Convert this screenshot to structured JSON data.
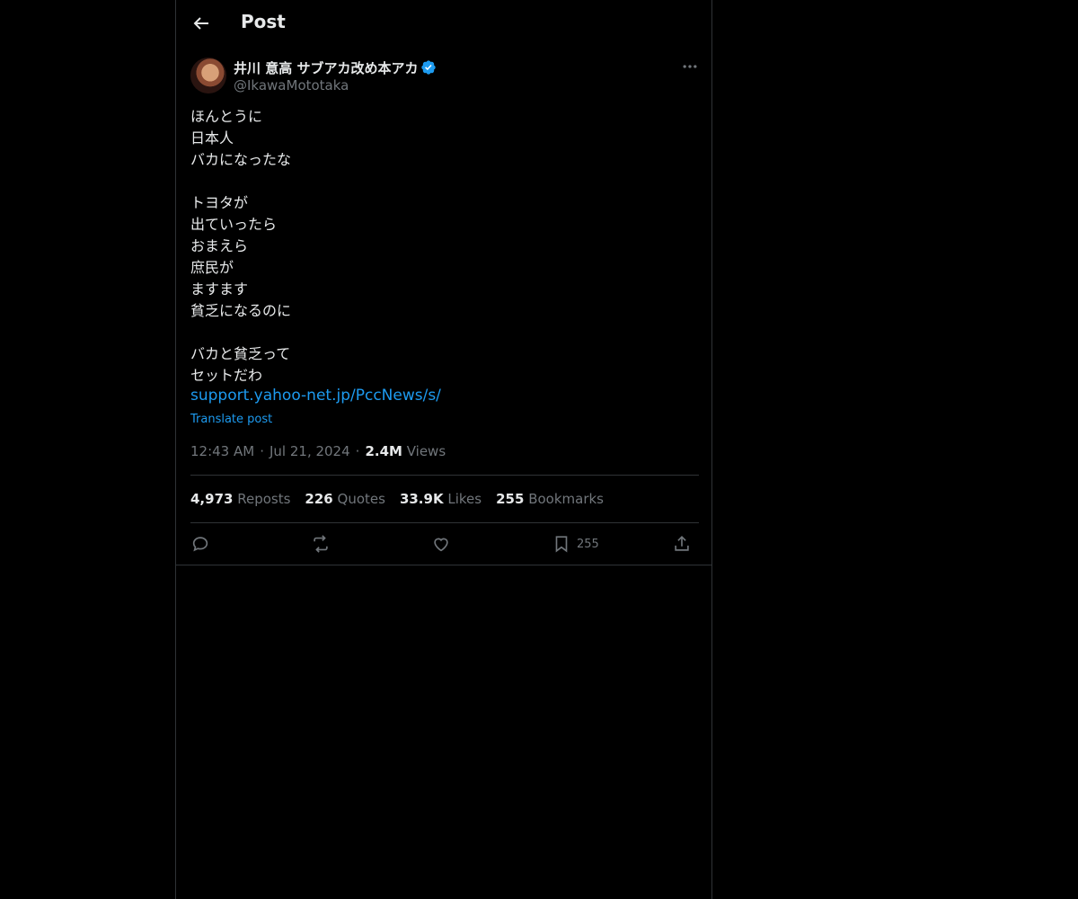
{
  "header": {
    "title": "Post"
  },
  "author": {
    "name": "井川 意高 サブアカ改め本アカ",
    "handle": "@IkawaMototaka"
  },
  "post": {
    "text": "ほんとうに\n日本人\nバカになったな\n\nトヨタが\n出ていったら\nおまえら\n庶民が\nますます\n貧乏になるのに\n\nバカと貧乏って\nセットだわ",
    "link": "support.yahoo-net.jp/PccNews/s/",
    "translate_label": "Translate post",
    "time": "12:43 AM",
    "date": "Jul 21, 2024",
    "views_value": "2.4M",
    "views_label": "Views"
  },
  "stats": {
    "reposts_value": "4,973",
    "reposts_label": "Reposts",
    "quotes_value": "226",
    "quotes_label": "Quotes",
    "likes_value": "33.9K",
    "likes_label": "Likes",
    "bookmarks_value": "255",
    "bookmarks_label": "Bookmarks"
  },
  "actions": {
    "bookmark_count": "255"
  },
  "colors": {
    "accent": "#1d9bf0",
    "muted": "#71767b",
    "text": "#e7e9ea",
    "border": "#2f3336",
    "background": "#000000"
  },
  "icons": [
    "back-arrow-icon",
    "verified-badge-icon",
    "more-icon",
    "reply-icon",
    "repost-icon",
    "like-icon",
    "bookmark-icon",
    "share-icon"
  ]
}
